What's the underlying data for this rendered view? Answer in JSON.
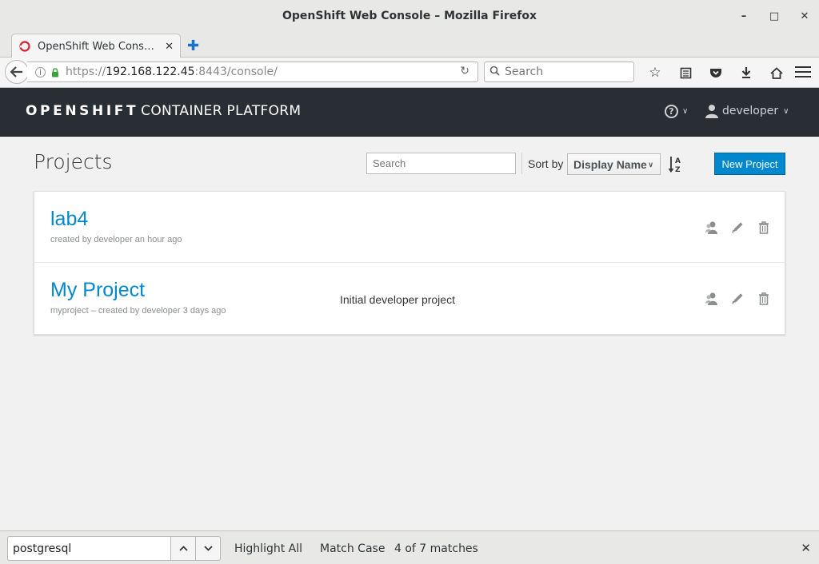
{
  "window": {
    "title": "OpenShift Web Console – Mozilla Firefox"
  },
  "tab": {
    "title": "OpenShift Web Cons…"
  },
  "address": {
    "scheme": "https://",
    "host": "192.168.122.45",
    "path": ":8443/console/"
  },
  "search": {
    "placeholder": "Search"
  },
  "header": {
    "brand_bold": "OPENSHIFT",
    "brand_rest": "CONTAINER PLATFORM",
    "user": "developer"
  },
  "main": {
    "title": "Projects",
    "filter_placeholder": "Search",
    "sort_label": "Sort by",
    "sort_value": "Display Name",
    "new_project_label": "New Project",
    "projects": [
      {
        "name": "lab4",
        "meta": "created by developer an hour ago",
        "description": ""
      },
      {
        "name": "My Project",
        "meta": "myproject – created by developer 3 days ago",
        "description": "Initial developer project"
      }
    ]
  },
  "findbar": {
    "query": "postgresql",
    "highlight_all": "Highlight All",
    "match_case": "Match Case",
    "matches": "4 of 7 matches"
  },
  "colors": {
    "accent": "#0088ce",
    "header_bg": "#292e34"
  }
}
